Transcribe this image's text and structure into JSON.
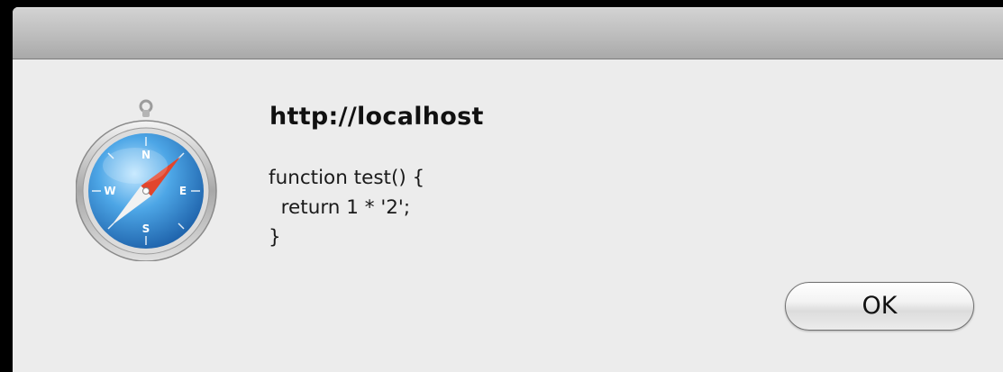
{
  "dialog": {
    "title": "http://localhost",
    "message": "function test() {\n  return 1 * '2';\n}",
    "ok_label": "OK"
  },
  "icon": {
    "name": "safari-compass-icon"
  },
  "colors": {
    "background": "#ececec",
    "titlebar": "#bdbdbd"
  }
}
